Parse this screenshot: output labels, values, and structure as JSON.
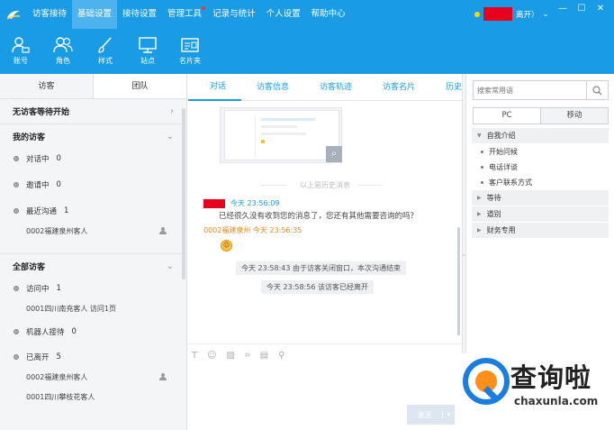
{
  "menu": [
    "访客接待",
    "基础设置",
    "接待设置",
    "管理工具",
    "记录与统计",
    "个人设置",
    "帮助中心"
  ],
  "menu_active_index": 1,
  "user": {
    "suffix": "离开）"
  },
  "toolbar": [
    {
      "label": "账号",
      "icon": "account-icon"
    },
    {
      "label": "角色",
      "icon": "role-icon"
    },
    {
      "label": "样式",
      "icon": "style-icon"
    },
    {
      "label": "站点",
      "icon": "site-icon"
    },
    {
      "label": "名片夹",
      "icon": "card-holder-icon"
    }
  ],
  "left": {
    "tabs": [
      "访客",
      "团队"
    ],
    "waiting": "无访客等待开始",
    "my_visitors": "我的访客",
    "my_rows": [
      {
        "label": "对话中",
        "count": "0"
      },
      {
        "label": "邀请中",
        "count": "0"
      },
      {
        "label": "最近沟通",
        "count": "1"
      }
    ],
    "my_sub": "0002福建泉州客人",
    "all_visitors": "全部访客",
    "all_rows": [
      {
        "label": "访问中",
        "count": "1"
      },
      {
        "label": "机器人接待",
        "count": "0"
      },
      {
        "label": "已离开",
        "count": "5"
      }
    ],
    "visiting_sub": "0001四川南充客人 访问1页",
    "left_subs": [
      "0002福建泉州客人",
      "0001四川攀枝花客人"
    ]
  },
  "center": {
    "tabs": [
      "对话",
      "访客信息",
      "访客轨迹",
      "访客名片",
      "历史"
    ],
    "history_hint": "以上是历史消息",
    "msg1_time": "今天 23:56:09",
    "msg1_text": "已经很久没有收到您的消息了，您还有其他需要咨询的吗？",
    "msg2_head": "0002福建泉州 今天 23:56:35",
    "sys1": "今天 23:58:43 由于访客关闭窗口，本次沟通结束",
    "sys2": "今天 23:58:56 该访客已经离开",
    "send_label": "发送"
  },
  "right": {
    "search_placeholder": "搜索常用语",
    "tabs": [
      "PC",
      "移动"
    ],
    "groups": [
      {
        "label": "自我介绍",
        "expanded": true,
        "items": [
          "开始问候",
          "电话详谈",
          "客户联系方式"
        ]
      },
      {
        "label": "等待",
        "expanded": false,
        "items": []
      },
      {
        "label": "道别",
        "expanded": false,
        "items": []
      },
      {
        "label": "财务专用",
        "expanded": false,
        "items": []
      }
    ]
  },
  "brand": {
    "cn": "查询啦",
    "en": "chaxunla.com"
  },
  "colors": {
    "primary": "#1a9be5",
    "redaction": "#e8001c",
    "brand_orange": "#ff8f1a",
    "brand_blue": "#1a7ee0"
  }
}
